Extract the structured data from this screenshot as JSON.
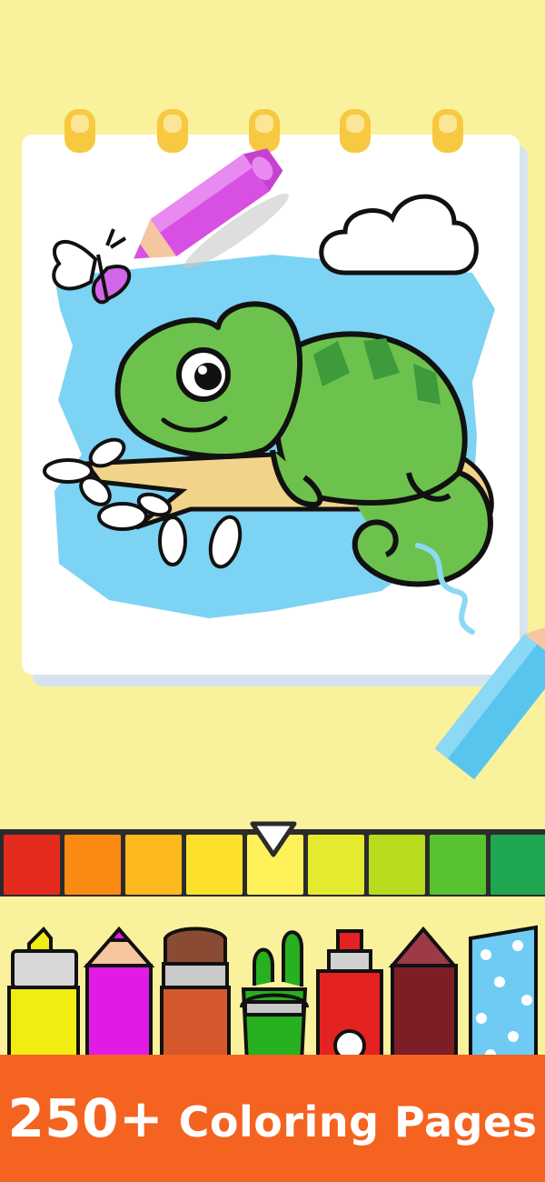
{
  "footer": {
    "count": "250+",
    "label": "Coloring Pages"
  },
  "palette": {
    "colors": [
      "#E52B1E",
      "#FB8A15",
      "#FBB91E",
      "#FDE02C",
      "#FFF159",
      "#E4EA2E",
      "#B7DB1D",
      "#57C331",
      "#1EA651"
    ],
    "selected_index": 4,
    "selector_icon": "triangle-down-icon"
  },
  "tools": [
    {
      "name": "highlighter-marker",
      "color": "#F1EC11"
    },
    {
      "name": "pencil",
      "color": "#E11AE6"
    },
    {
      "name": "paintbrush",
      "color": "#D4582C"
    },
    {
      "name": "paint-bucket",
      "color": "#27B01F"
    },
    {
      "name": "spray-can",
      "color": "#E42222"
    },
    {
      "name": "glitter-crayon",
      "color": "#7D1D25"
    },
    {
      "name": "pattern-crayon",
      "color": "#6FCBF4"
    }
  ],
  "drawing": {
    "subject": "chameleon-on-branch",
    "body_color": "#6DC24D",
    "sky_color": "#7DD3F3",
    "branch_color": "#F2D38A"
  }
}
